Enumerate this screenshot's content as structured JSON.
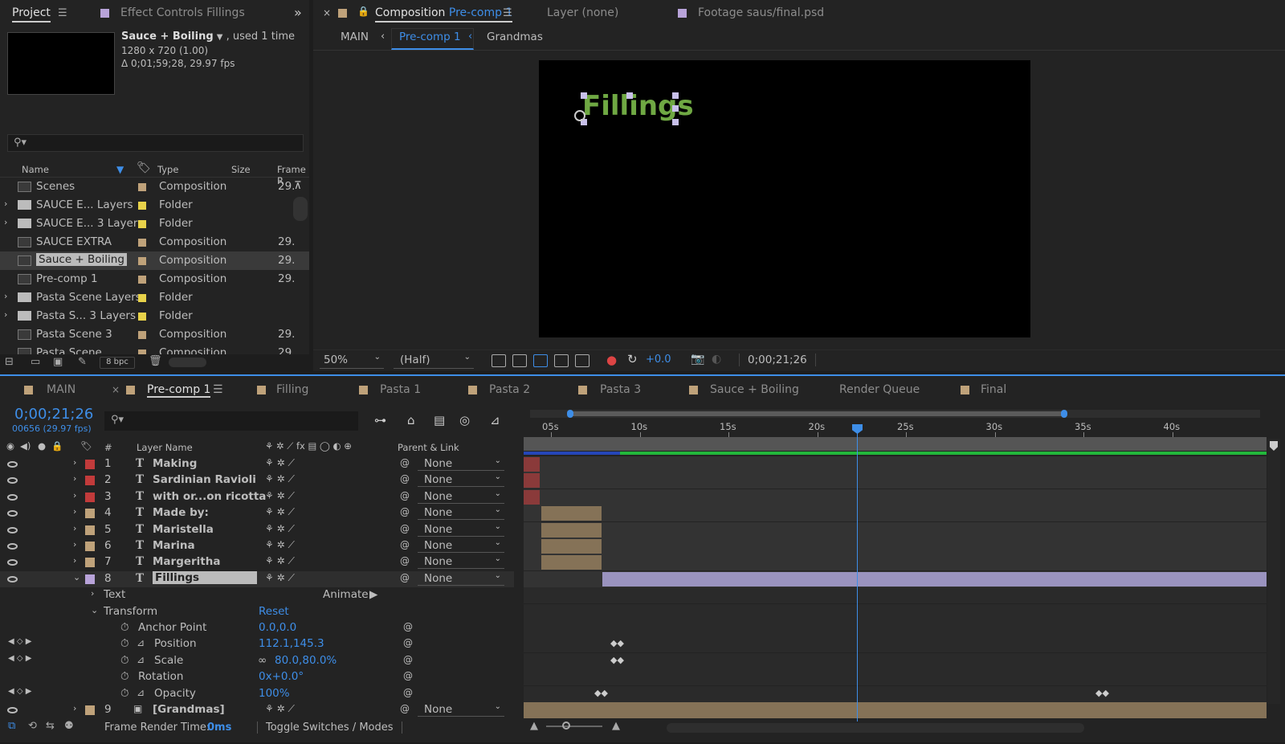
{
  "project_panel": {
    "tab": "Project",
    "effect_tab": "Effect Controls Fillings",
    "item_name": "Sauce + Boiling",
    "used": ", used 1 time",
    "res": "1280 x 720 (1.00)",
    "dur": "Δ 0;01;59;28, 29.97 fps",
    "search_icon": "search-icon",
    "cols": {
      "name": "Name",
      "type": "Type",
      "size": "Size",
      "frame": "Frame R"
    },
    "items": [
      {
        "name": "Scenes",
        "type": "Composition",
        "fr": "29.",
        "color": "#bfa27a",
        "kind": "comp",
        "twirl": false
      },
      {
        "name": "SAUCE E... Layers",
        "type": "Folder",
        "fr": "",
        "color": "#e8d24a",
        "kind": "folder",
        "twirl": true
      },
      {
        "name": "SAUCE E... 3 Layers",
        "type": "Folder",
        "fr": "",
        "color": "#e8d24a",
        "kind": "folder",
        "twirl": true
      },
      {
        "name": "SAUCE EXTRA",
        "type": "Composition",
        "fr": "29.",
        "color": "#bfa27a",
        "kind": "comp",
        "twirl": false
      },
      {
        "name": "Sauce + Boiling",
        "type": "Composition",
        "fr": "29.",
        "color": "#bfa27a",
        "kind": "comp",
        "twirl": false,
        "selected": true
      },
      {
        "name": "Pre-comp 1",
        "type": "Composition",
        "fr": "29.",
        "color": "#bfa27a",
        "kind": "comp",
        "twirl": false
      },
      {
        "name": "Pasta Scene Layers",
        "type": "Folder",
        "fr": "",
        "color": "#e8d24a",
        "kind": "folder",
        "twirl": true
      },
      {
        "name": "Pasta S... 3 Layers",
        "type": "Folder",
        "fr": "",
        "color": "#e8d24a",
        "kind": "folder",
        "twirl": true
      },
      {
        "name": "Pasta Scene 3",
        "type": "Composition",
        "fr": "29.",
        "color": "#bfa27a",
        "kind": "comp",
        "twirl": false
      },
      {
        "name": "Pasta Scene",
        "type": "Composition",
        "fr": "29.",
        "color": "#bfa27a",
        "kind": "comp",
        "twirl": false
      }
    ],
    "bpc": "8 bpc"
  },
  "viewer": {
    "tab_comp": "Composition",
    "tab_comp_name": "Pre-comp 1",
    "tab_layer": "Layer (none)",
    "tab_footage": "Footage saus/final.psd",
    "breadcrumbs": [
      "MAIN",
      "Pre-comp 1",
      "Grandmas"
    ],
    "canvas_text": "Fillings",
    "zoom": "50%",
    "res": "(Half)",
    "exposure": "+0.0",
    "timecode": "0;00;21;26"
  },
  "timeline": {
    "tabs": [
      "MAIN",
      "Pre-comp 1",
      "Filling",
      "Pasta 1",
      "Pasta 2",
      "Pasta 3",
      "Sauce + Boiling",
      "Render Queue",
      "Final"
    ],
    "timecode": "0;00;21;26",
    "frames": "00656 (29.97 fps)",
    "col_layer": "Layer Name",
    "col_parent": "Parent & Link",
    "col_num": "#",
    "ruler": [
      "05s",
      "10s",
      "15s",
      "20s",
      "25s",
      "30s",
      "35s",
      "40s"
    ],
    "layers": [
      {
        "n": "1",
        "name": "Making",
        "color": "#c23b3b",
        "parent": "None"
      },
      {
        "n": "2",
        "name": "Sardinian Ravioli",
        "color": "#c23b3b",
        "parent": "None"
      },
      {
        "n": "3",
        "name": "with or...on ricotta",
        "color": "#c23b3b",
        "parent": "None"
      },
      {
        "n": "4",
        "name": "Made by:",
        "color": "#bfa27a",
        "parent": "None"
      },
      {
        "n": "5",
        "name": "Maristella",
        "color": "#bfa27a",
        "parent": "None"
      },
      {
        "n": "6",
        "name": "Marina",
        "color": "#bfa27a",
        "parent": "None"
      },
      {
        "n": "7",
        "name": "Margeritha",
        "color": "#bfa27a",
        "parent": "None"
      },
      {
        "n": "8",
        "name": "Fillings",
        "color": "#b8a3d9",
        "parent": "None"
      }
    ],
    "layer9": {
      "n": "9",
      "name": "[Grandmas]",
      "parent": "None"
    },
    "props": {
      "text": "Text",
      "animate": "Animate:",
      "transform": "Transform",
      "reset": "Reset",
      "anchor": "Anchor Point",
      "anchor_v": "0.0,0.0",
      "position": "Position",
      "position_v": "112.1,145.3",
      "scale": "Scale",
      "scale_v": "80.0,80.0%",
      "rotation": "Rotation",
      "rotation_v": "0x+0.0°",
      "opacity": "Opacity",
      "opacity_v": "100%"
    },
    "footer_render": "Frame Render Time:",
    "footer_ms": "0ms",
    "footer_toggle": "Toggle Switches / Modes"
  }
}
